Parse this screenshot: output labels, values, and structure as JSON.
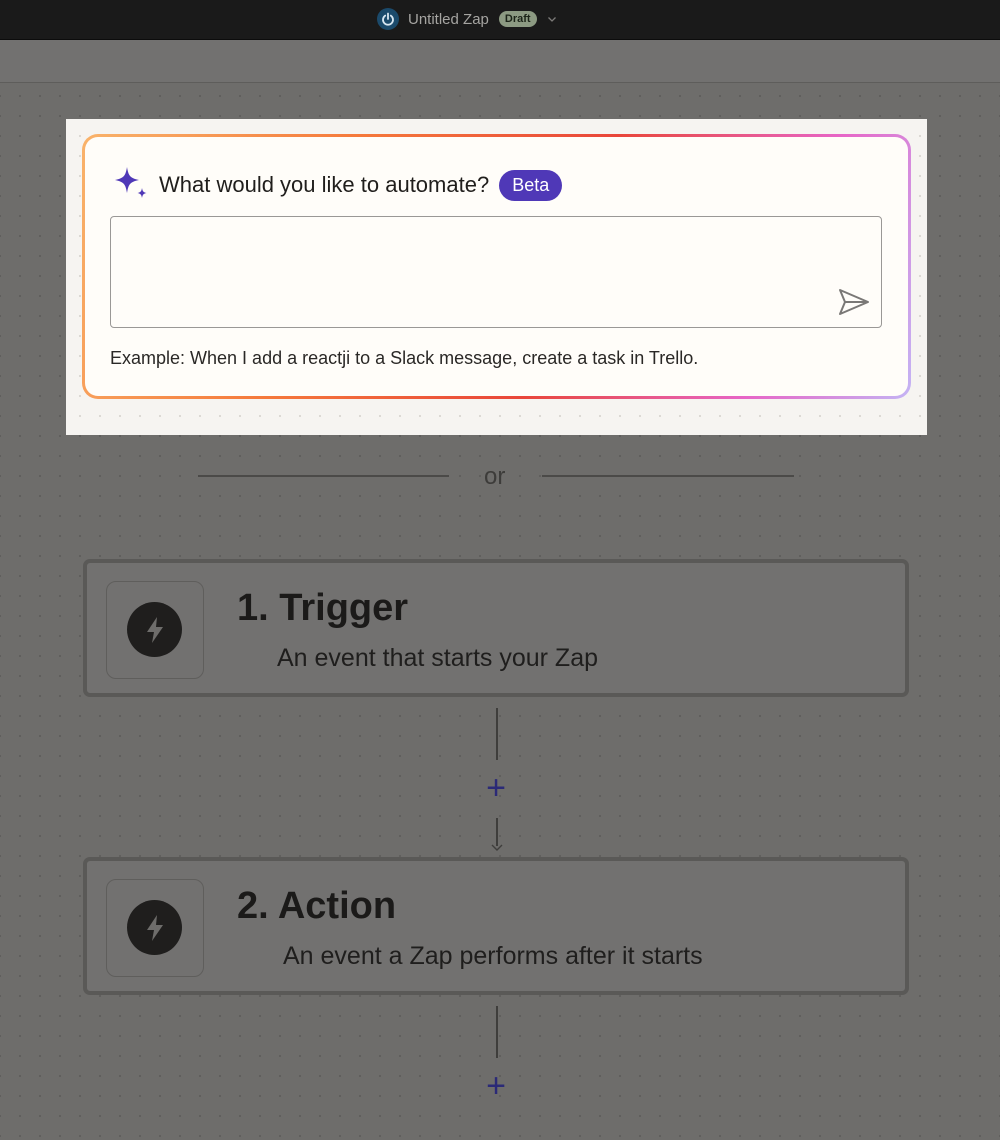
{
  "header": {
    "zap_name": "Untitled Zap",
    "status_badge": "Draft"
  },
  "ai_prompt": {
    "question": "What would you like to automate?",
    "badge": "Beta",
    "input_value": "",
    "example": "Example: When I add a reactji to a Slack message, create a task in Trello."
  },
  "divider": {
    "label": "or"
  },
  "steps": [
    {
      "title": "1. Trigger",
      "description": "An event that starts your Zap"
    },
    {
      "title": "2. Action",
      "description": "An event a Zap performs after it starts"
    }
  ],
  "add_step_label": "+",
  "colors": {
    "accent_purple": "#4f38b7",
    "draft_badge": "#8c9a82",
    "gradient_start": "#f9b36b",
    "gradient_mid": "#e9463a",
    "gradient_end": "#c4b4f4"
  }
}
